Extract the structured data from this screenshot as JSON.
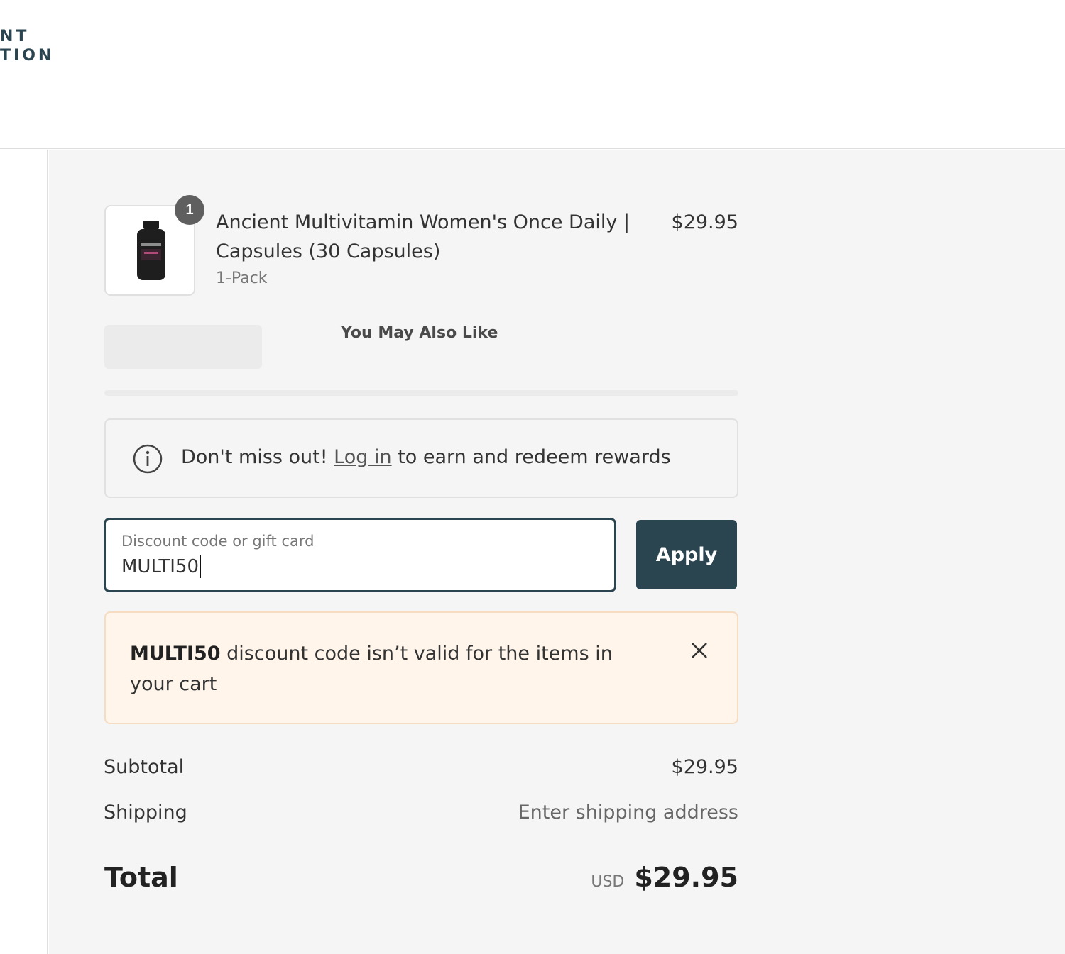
{
  "header": {
    "logo_line1": "NT",
    "logo_line2": "TION"
  },
  "cart": {
    "item": {
      "quantity": "1",
      "title": "Ancient Multivitamin Women's Once Daily | Capsules (30 Capsules)",
      "variant": "1-Pack",
      "price": "$29.95"
    },
    "upsell_title": "You May Also Like"
  },
  "rewards": {
    "prefix": "Don't miss out!",
    "link": "Log in",
    "suffix": "to earn and redeem rewards"
  },
  "discount": {
    "label": "Discount code or gift card",
    "value": "MULTI50",
    "apply_label": "Apply",
    "error_code": "MULTI50",
    "error_message": "discount code isn’t valid for the items in your cart"
  },
  "totals": {
    "subtotal_label": "Subtotal",
    "subtotal_value": "$29.95",
    "shipping_label": "Shipping",
    "shipping_value": "Enter shipping address",
    "total_label": "Total",
    "currency": "USD",
    "total_value": "$29.95"
  },
  "colors": {
    "brand": "#2a4450",
    "summary_bg": "#f5f5f5",
    "error_bg": "#fff5ea"
  }
}
